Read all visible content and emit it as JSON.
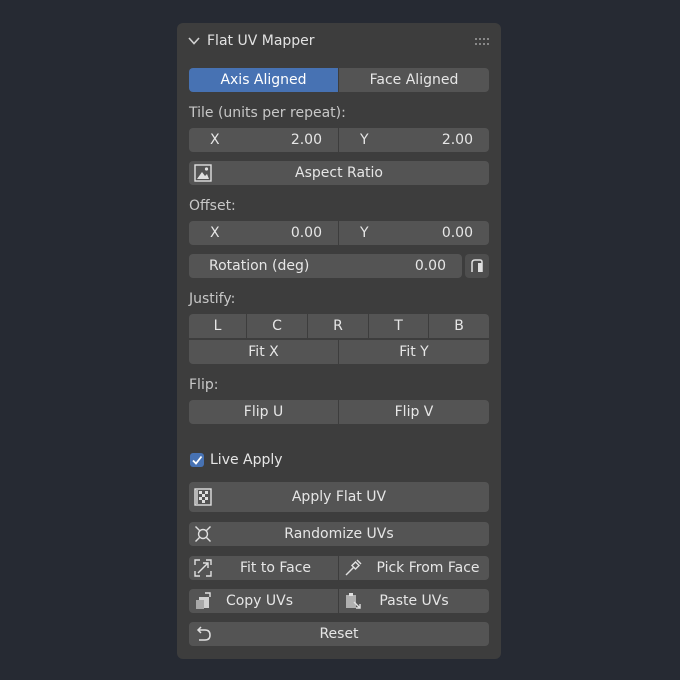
{
  "panel": {
    "title": "Flat UV Mapper",
    "collapse_icon": "chevron-down-icon",
    "grip_icon": "drag-grip-icon"
  },
  "mode": {
    "options": [
      "Axis Aligned",
      "Face Aligned"
    ],
    "selected": "Axis Aligned"
  },
  "tile": {
    "label": "Tile (units per repeat):",
    "x_label": "X",
    "x_value": "2.00",
    "y_label": "Y",
    "y_value": "2.00",
    "aspect_label": "Aspect Ratio",
    "aspect_icon": "image-icon"
  },
  "offset": {
    "label": "Offset:",
    "x_label": "X",
    "x_value": "0.00",
    "y_label": "Y",
    "y_value": "0.00"
  },
  "rotation": {
    "label": "Rotation (deg)",
    "value": "0.00",
    "icon": "rotate-icon"
  },
  "justify": {
    "label": "Justify:",
    "buttons": [
      "L",
      "C",
      "R",
      "T",
      "B"
    ],
    "fit_x": "Fit X",
    "fit_y": "Fit Y"
  },
  "flip": {
    "label": "Flip:",
    "u": "Flip U",
    "v": "Flip V"
  },
  "live_apply": {
    "label": "Live Apply",
    "checked": true
  },
  "actions": {
    "apply": "Apply Flat UV",
    "randomize": "Randomize UVs",
    "fit_face": "Fit to Face",
    "pick_face": "Pick From Face",
    "copy": "Copy UVs",
    "paste": "Paste UVs",
    "reset": "Reset"
  },
  "colors": {
    "accent": "#4772b3",
    "panel": "#3d3d3d",
    "button": "#545454",
    "background": "#262a33"
  }
}
